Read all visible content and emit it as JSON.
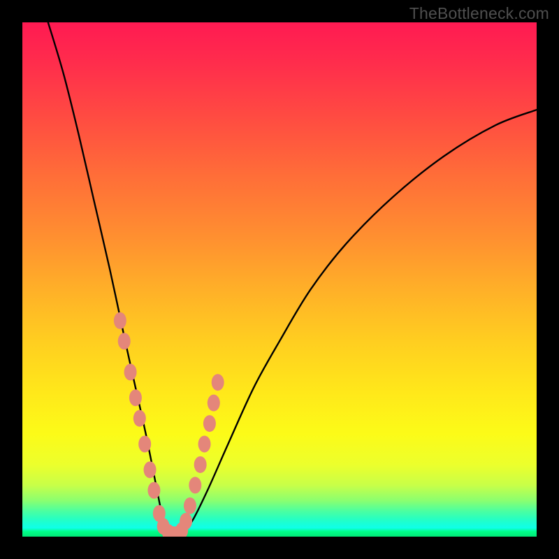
{
  "watermark": "TheBottleneck.com",
  "colors": {
    "frame": "#000000",
    "gradient_top": "#ff1a52",
    "gradient_mid": "#ffe81a",
    "gradient_bottom": "#00e878",
    "curve": "#000000",
    "marker": "#e4867a",
    "marker_stroke": "#a24f46"
  },
  "chart_data": {
    "type": "line",
    "title": "",
    "xlabel": "",
    "ylabel": "",
    "xlim": [
      0,
      100
    ],
    "ylim": [
      0,
      100
    ],
    "note": "Axes are unlabeled in the source image; x and y are normalized 0–100. The curve is a V-shaped dip whose minimum reaches y≈0 near x≈28; values are read off the plot area proportionally.",
    "series": [
      {
        "name": "curve",
        "x": [
          5,
          8,
          11,
          14,
          17,
          20,
          22,
          24,
          26,
          27,
          28,
          29,
          30,
          31,
          33,
          36,
          40,
          45,
          50,
          56,
          63,
          72,
          82,
          92,
          100
        ],
        "y": [
          100,
          90,
          78,
          65,
          52,
          38,
          29,
          20,
          10,
          5,
          1,
          0,
          0,
          1,
          3,
          9,
          18,
          29,
          38,
          48,
          57,
          66,
          74,
          80,
          83
        ]
      }
    ],
    "markers": {
      "name": "highlighted-points",
      "note": "Salmon-colored dots clustered on both flanks of the V near its lower portion and along the flat bottom.",
      "x": [
        19.0,
        19.8,
        21.0,
        22.0,
        22.8,
        23.8,
        24.8,
        25.6,
        26.6,
        27.4,
        28.4,
        29.2,
        30.0,
        31.0,
        31.8,
        32.6,
        33.6,
        34.6,
        35.4,
        36.4,
        37.2,
        38.0
      ],
      "y": [
        42.0,
        38.0,
        32.0,
        27.0,
        23.0,
        18.0,
        13.0,
        9.0,
        4.5,
        2.0,
        0.8,
        0.4,
        0.4,
        1.2,
        3.0,
        6.0,
        10.0,
        14.0,
        18.0,
        22.0,
        26.0,
        30.0
      ]
    }
  }
}
